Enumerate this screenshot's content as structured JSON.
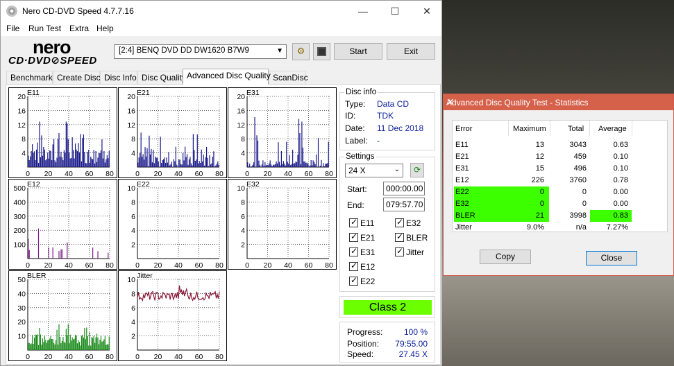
{
  "window": {
    "title": "Nero CD-DVD Speed 4.7.7.16",
    "minimize": "—",
    "maximize": "☐",
    "close": "✕"
  },
  "menu": [
    "File",
    "Run Test",
    "Extra",
    "Help"
  ],
  "logo": {
    "top": "nero",
    "bottom": "CD·DVD⊘SPEED"
  },
  "toolbar": {
    "drive": "[2:4]  BENQ DVD DD DW1620 B7W9",
    "start": "Start",
    "exit": "Exit"
  },
  "tabs": [
    "Benchmark",
    "Create Disc",
    "Disc Info",
    "Disc Quality",
    "Advanced Disc Quality",
    "ScanDisc"
  ],
  "active_tab": "Advanced Disc Quality",
  "disc_info": {
    "heading": "Disc info",
    "type_label": "Type:",
    "type": "Data CD",
    "id_label": "ID:",
    "id": "TDK",
    "date_label": "Date:",
    "date": "11 Dec 2018",
    "label_label": "Label:",
    "label": "-"
  },
  "settings": {
    "heading": "Settings",
    "speed": "24 X",
    "start_label": "Start:",
    "start": "000:00.00",
    "end_label": "End:",
    "end": "079:57.70",
    "checks": [
      "E11",
      "E32",
      "E21",
      "BLER",
      "E31",
      "Jitter",
      "E12",
      "E22"
    ]
  },
  "class_label": "Class 2",
  "progress": {
    "progress_label": "Progress:",
    "progress": "100 %",
    "position_label": "Position:",
    "position": "79:55.00",
    "speed_label": "Speed:",
    "speed": "27.45 X"
  },
  "chart_data": [
    {
      "type": "bar",
      "title": "E11",
      "ylim": [
        0,
        20
      ],
      "yticks": [
        4,
        8,
        12,
        16,
        20
      ],
      "xticks": [
        0,
        20,
        40,
        60,
        80
      ],
      "color": "#1a1a8a"
    },
    {
      "type": "bar",
      "title": "E21",
      "ylim": [
        0,
        20
      ],
      "yticks": [
        4,
        8,
        12,
        16,
        20
      ],
      "xticks": [
        0,
        20,
        40,
        60,
        80
      ],
      "color": "#1a1a8a"
    },
    {
      "type": "bar",
      "title": "E31",
      "ylim": [
        0,
        20
      ],
      "yticks": [
        4,
        8,
        12,
        16,
        20
      ],
      "xticks": [
        0,
        20,
        40,
        60,
        80
      ],
      "color": "#1a1a8a"
    },
    {
      "type": "bar",
      "title": "E12",
      "ylim": [
        0,
        500
      ],
      "yticks": [
        100,
        200,
        300,
        400,
        500
      ],
      "xticks": [
        0,
        20,
        40,
        60,
        80
      ],
      "color": "#7a1a8a"
    },
    {
      "type": "bar",
      "title": "E22",
      "ylim": [
        0,
        10
      ],
      "yticks": [
        2,
        4,
        6,
        8,
        10
      ],
      "xticks": [
        0,
        20,
        40,
        60,
        80
      ],
      "color": "#1a1a8a"
    },
    {
      "type": "bar",
      "title": "E32",
      "ylim": [
        0,
        10
      ],
      "yticks": [
        2,
        4,
        6,
        8,
        10
      ],
      "xticks": [
        0,
        20,
        40,
        60,
        80
      ],
      "color": "#1a1a8a"
    },
    {
      "type": "bar",
      "title": "BLER",
      "ylim": [
        0,
        50
      ],
      "yticks": [
        10,
        20,
        30,
        40,
        50
      ],
      "xticks": [
        0,
        20,
        40,
        60,
        80
      ],
      "color": "#1a8a1a"
    },
    {
      "type": "line",
      "title": "Jitter",
      "ylim": [
        0,
        10
      ],
      "yticks": [
        2,
        4,
        6,
        8,
        10
      ],
      "xticks": [
        0,
        20,
        40,
        60,
        80
      ],
      "color": "#8a1a3a"
    }
  ],
  "stats": {
    "title": "Advanced Disc Quality Test - Statistics",
    "close": "✕",
    "headers": [
      "Error",
      "Maximum",
      "Total",
      "Average"
    ],
    "rows": [
      {
        "error": "E11",
        "max": "13",
        "total": "3043",
        "avg": "0.63"
      },
      {
        "error": "E21",
        "max": "12",
        "total": "459",
        "avg": "0.10"
      },
      {
        "error": "E31",
        "max": "15",
        "total": "496",
        "avg": "0.10"
      },
      {
        "error": "E12",
        "max": "226",
        "total": "3760",
        "avg": "0.78"
      },
      {
        "error": "E22",
        "max": "0",
        "total": "0",
        "avg": "0.00"
      },
      {
        "error": "E32",
        "max": "0",
        "total": "0",
        "avg": "0.00"
      },
      {
        "error": "BLER",
        "max": "21",
        "total": "3998",
        "avg": "0.83"
      },
      {
        "error": "Jitter",
        "max": "9.0%",
        "total": "n/a",
        "avg": "7.27%"
      }
    ],
    "copy": "Copy",
    "close_btn": "Close",
    "highlight_color": "#3cff00"
  }
}
